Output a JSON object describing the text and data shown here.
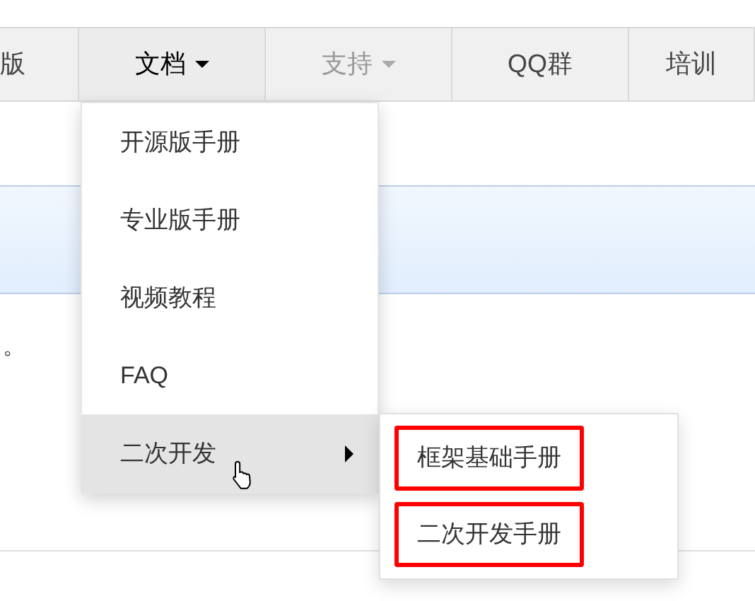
{
  "nav": [
    {
      "label": "版",
      "caret": false,
      "muted": false,
      "expanded": false
    },
    {
      "label": "文档",
      "caret": true,
      "muted": false,
      "expanded": true
    },
    {
      "label": "支持",
      "caret": true,
      "muted": true,
      "expanded": false
    },
    {
      "label": "QQ群",
      "caret": false,
      "muted": false,
      "expanded": false
    },
    {
      "label": "培训",
      "caret": false,
      "muted": false,
      "expanded": false
    }
  ],
  "page_text": "。",
  "dropdown": [
    {
      "label": "开源版手册",
      "hovered": false,
      "submenu": false
    },
    {
      "label": "专业版手册",
      "hovered": false,
      "submenu": false
    },
    {
      "label": "视频教程",
      "hovered": false,
      "submenu": false
    },
    {
      "label": "FAQ",
      "hovered": false,
      "submenu": false
    },
    {
      "label": "二次开发",
      "hovered": true,
      "submenu": true
    }
  ],
  "submenu": [
    {
      "label": "框架基础手册",
      "highlighted": true
    },
    {
      "label": "二次开发手册",
      "highlighted": true
    }
  ]
}
